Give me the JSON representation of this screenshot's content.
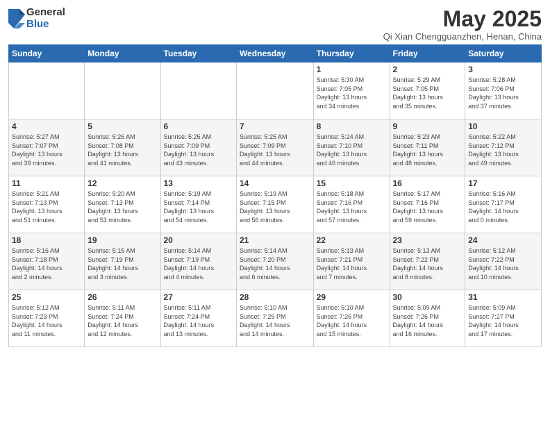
{
  "logo": {
    "general": "General",
    "blue": "Blue"
  },
  "title": "May 2025",
  "location": "Qi Xian Chengguanzhen, Henan, China",
  "days_of_week": [
    "Sunday",
    "Monday",
    "Tuesday",
    "Wednesday",
    "Thursday",
    "Friday",
    "Saturday"
  ],
  "weeks": [
    [
      {
        "day": "",
        "info": ""
      },
      {
        "day": "",
        "info": ""
      },
      {
        "day": "",
        "info": ""
      },
      {
        "day": "",
        "info": ""
      },
      {
        "day": "1",
        "info": "Sunrise: 5:30 AM\nSunset: 7:05 PM\nDaylight: 13 hours\nand 34 minutes."
      },
      {
        "day": "2",
        "info": "Sunrise: 5:29 AM\nSunset: 7:05 PM\nDaylight: 13 hours\nand 35 minutes."
      },
      {
        "day": "3",
        "info": "Sunrise: 5:28 AM\nSunset: 7:06 PM\nDaylight: 13 hours\nand 37 minutes."
      }
    ],
    [
      {
        "day": "4",
        "info": "Sunrise: 5:27 AM\nSunset: 7:07 PM\nDaylight: 13 hours\nand 39 minutes."
      },
      {
        "day": "5",
        "info": "Sunrise: 5:26 AM\nSunset: 7:08 PM\nDaylight: 13 hours\nand 41 minutes."
      },
      {
        "day": "6",
        "info": "Sunrise: 5:25 AM\nSunset: 7:09 PM\nDaylight: 13 hours\nand 43 minutes."
      },
      {
        "day": "7",
        "info": "Sunrise: 5:25 AM\nSunset: 7:09 PM\nDaylight: 13 hours\nand 44 minutes."
      },
      {
        "day": "8",
        "info": "Sunrise: 5:24 AM\nSunset: 7:10 PM\nDaylight: 13 hours\nand 46 minutes."
      },
      {
        "day": "9",
        "info": "Sunrise: 5:23 AM\nSunset: 7:11 PM\nDaylight: 13 hours\nand 48 minutes."
      },
      {
        "day": "10",
        "info": "Sunrise: 5:22 AM\nSunset: 7:12 PM\nDaylight: 13 hours\nand 49 minutes."
      }
    ],
    [
      {
        "day": "11",
        "info": "Sunrise: 5:21 AM\nSunset: 7:13 PM\nDaylight: 13 hours\nand 51 minutes."
      },
      {
        "day": "12",
        "info": "Sunrise: 5:20 AM\nSunset: 7:13 PM\nDaylight: 13 hours\nand 53 minutes."
      },
      {
        "day": "13",
        "info": "Sunrise: 5:19 AM\nSunset: 7:14 PM\nDaylight: 13 hours\nand 54 minutes."
      },
      {
        "day": "14",
        "info": "Sunrise: 5:19 AM\nSunset: 7:15 PM\nDaylight: 13 hours\nand 56 minutes."
      },
      {
        "day": "15",
        "info": "Sunrise: 5:18 AM\nSunset: 7:16 PM\nDaylight: 13 hours\nand 57 minutes."
      },
      {
        "day": "16",
        "info": "Sunrise: 5:17 AM\nSunset: 7:16 PM\nDaylight: 13 hours\nand 59 minutes."
      },
      {
        "day": "17",
        "info": "Sunrise: 5:16 AM\nSunset: 7:17 PM\nDaylight: 14 hours\nand 0 minutes."
      }
    ],
    [
      {
        "day": "18",
        "info": "Sunrise: 5:16 AM\nSunset: 7:18 PM\nDaylight: 14 hours\nand 2 minutes."
      },
      {
        "day": "19",
        "info": "Sunrise: 5:15 AM\nSunset: 7:19 PM\nDaylight: 14 hours\nand 3 minutes."
      },
      {
        "day": "20",
        "info": "Sunrise: 5:14 AM\nSunset: 7:19 PM\nDaylight: 14 hours\nand 4 minutes."
      },
      {
        "day": "21",
        "info": "Sunrise: 5:14 AM\nSunset: 7:20 PM\nDaylight: 14 hours\nand 6 minutes."
      },
      {
        "day": "22",
        "info": "Sunrise: 5:13 AM\nSunset: 7:21 PM\nDaylight: 14 hours\nand 7 minutes."
      },
      {
        "day": "23",
        "info": "Sunrise: 5:13 AM\nSunset: 7:22 PM\nDaylight: 14 hours\nand 8 minutes."
      },
      {
        "day": "24",
        "info": "Sunrise: 5:12 AM\nSunset: 7:22 PM\nDaylight: 14 hours\nand 10 minutes."
      }
    ],
    [
      {
        "day": "25",
        "info": "Sunrise: 5:12 AM\nSunset: 7:23 PM\nDaylight: 14 hours\nand 11 minutes."
      },
      {
        "day": "26",
        "info": "Sunrise: 5:11 AM\nSunset: 7:24 PM\nDaylight: 14 hours\nand 12 minutes."
      },
      {
        "day": "27",
        "info": "Sunrise: 5:11 AM\nSunset: 7:24 PM\nDaylight: 14 hours\nand 13 minutes."
      },
      {
        "day": "28",
        "info": "Sunrise: 5:10 AM\nSunset: 7:25 PM\nDaylight: 14 hours\nand 14 minutes."
      },
      {
        "day": "29",
        "info": "Sunrise: 5:10 AM\nSunset: 7:26 PM\nDaylight: 14 hours\nand 15 minutes."
      },
      {
        "day": "30",
        "info": "Sunrise: 5:09 AM\nSunset: 7:26 PM\nDaylight: 14 hours\nand 16 minutes."
      },
      {
        "day": "31",
        "info": "Sunrise: 5:09 AM\nSunset: 7:27 PM\nDaylight: 14 hours\nand 17 minutes."
      }
    ]
  ]
}
